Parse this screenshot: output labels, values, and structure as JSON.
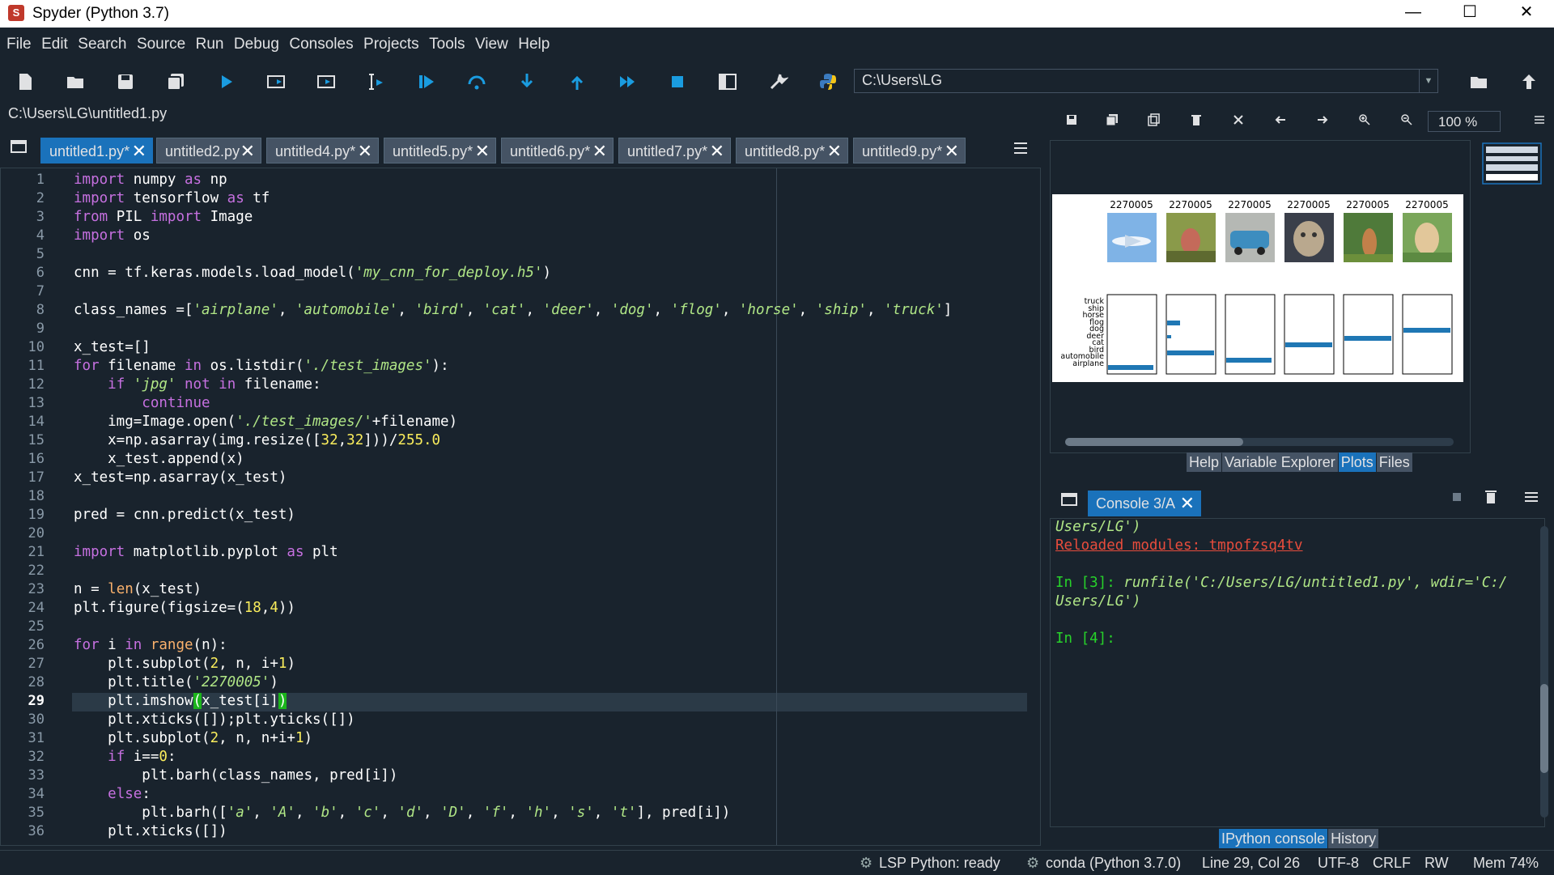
{
  "window": {
    "title": "Spyder (Python 3.7)",
    "app_icon": "spyder-icon",
    "minimize": "—",
    "maximize": "☐",
    "close": "✕"
  },
  "menu": [
    "File",
    "Edit",
    "Search",
    "Source",
    "Run",
    "Debug",
    "Consoles",
    "Projects",
    "Tools",
    "View",
    "Help"
  ],
  "toolbar": {
    "working_dir": "C:\\Users\\LG"
  },
  "editor": {
    "file_path": "C:\\Users\\LG\\untitled1.py",
    "tabs": [
      "untitled1.py*",
      "untitled2.py",
      "untitled4.py*",
      "untitled5.py*",
      "untitled6.py*",
      "untitled7.py*",
      "untitled8.py*",
      "untitled9.py*"
    ],
    "line_numbers": [
      "1",
      "2",
      "3",
      "4",
      "5",
      "6",
      "7",
      "8",
      "9",
      "10",
      "11",
      "12",
      "13",
      "14",
      "15",
      "16",
      "17",
      "18",
      "19",
      "20",
      "21",
      "22",
      "23",
      "24",
      "25",
      "26",
      "27",
      "28",
      "29",
      "30",
      "31",
      "32",
      "33",
      "34",
      "35",
      "36"
    ],
    "current_line": 29
  },
  "plots": {
    "zoom": "100 %",
    "titles": [
      "2270005",
      "2270005",
      "2270005",
      "2270005",
      "2270005",
      "2270005"
    ],
    "ylabels": [
      "truck",
      "ship",
      "horse",
      "flog",
      "dog",
      "deer",
      "cat",
      "bird",
      "automobile",
      "airplane"
    ],
    "tabs": [
      "Help",
      "Variable Explorer",
      "Plots",
      "Files"
    ]
  },
  "console": {
    "tab": "Console 3/A",
    "tabs": [
      "IPython console",
      "History"
    ],
    "lines": {
      "l1": "Users/LG')",
      "l2": "Reloaded modules: tmpofzsq4tv",
      "l3_prompt": "In [3]: ",
      "l3_code": "runfile('C:/Users/LG/untitled1.py', wdir='C:/",
      "l4": "Users/LG')",
      "l5": "In [4]:"
    }
  },
  "status": {
    "lsp": "LSP Python: ready",
    "conda": "conda (Python 3.7.0)",
    "position": "Line 29, Col 26",
    "encoding": "UTF-8",
    "eol": "CRLF",
    "rw": "RW",
    "mem": "Mem 74%"
  },
  "colors": {
    "accent": "#1a72bb",
    "background": "#19232d",
    "keyword": "#c670e0",
    "string": "#b0e686",
    "number": "#faed5c",
    "builtin": "#fab16c",
    "bar": "#1f77b4"
  }
}
